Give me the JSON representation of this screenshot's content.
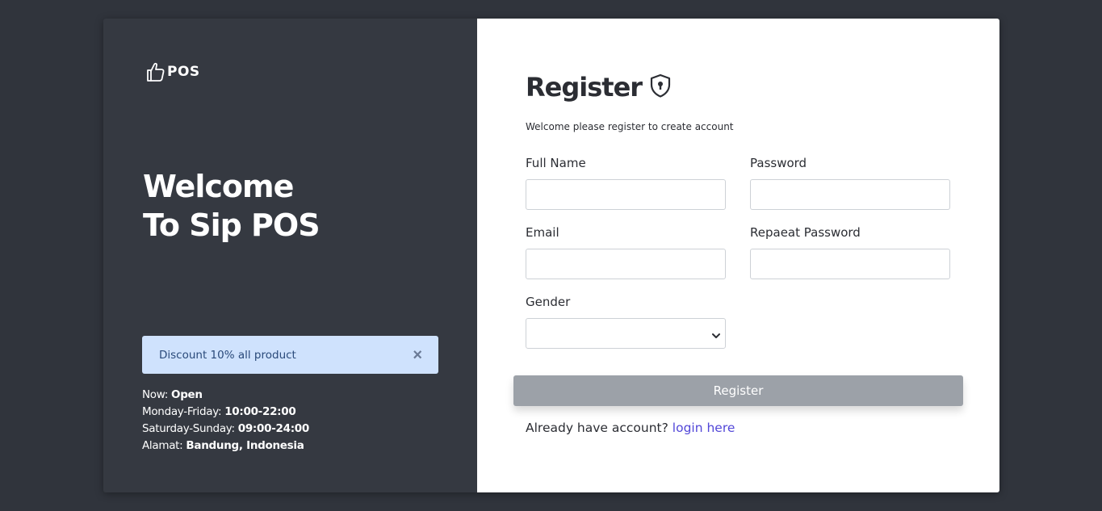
{
  "brand": {
    "logo_text": "POS",
    "icon": "thumbs-up-icon"
  },
  "hero": {
    "line1": "Welcome",
    "line2": "To Sip POS"
  },
  "alert": {
    "text": "Discount 10% all product",
    "close_symbol": "×"
  },
  "info": {
    "now_label": "Now: ",
    "now_value": "Open",
    "weekday_label": "Monday-Friday: ",
    "weekday_value": "10:00-22:00",
    "weekend_label": "Saturday-Sunday: ",
    "weekend_value": "09:00-24:00",
    "address_label": "Alamat: ",
    "address_value": "Bandung, Indonesia"
  },
  "form": {
    "title": "Register",
    "title_icon": "shield-lock-icon",
    "subtitle": "Welcome please register to create account",
    "full_name_label": "Full Name",
    "full_name_value": "",
    "password_label": "Password",
    "password_value": "",
    "email_label": "Email",
    "email_value": "",
    "repeat_password_label": "Repaeat Password",
    "repeat_password_value": "",
    "gender_label": "Gender",
    "gender_selected": "",
    "submit_label": "Register",
    "login_prompt": "Already have account? ",
    "login_link": "login here"
  },
  "colors": {
    "page_bg": "#30343c",
    "panel_bg": "#353941",
    "alert_bg": "#cfe2fd",
    "button_bg": "#9ca1a8",
    "link": "#5247d8"
  }
}
